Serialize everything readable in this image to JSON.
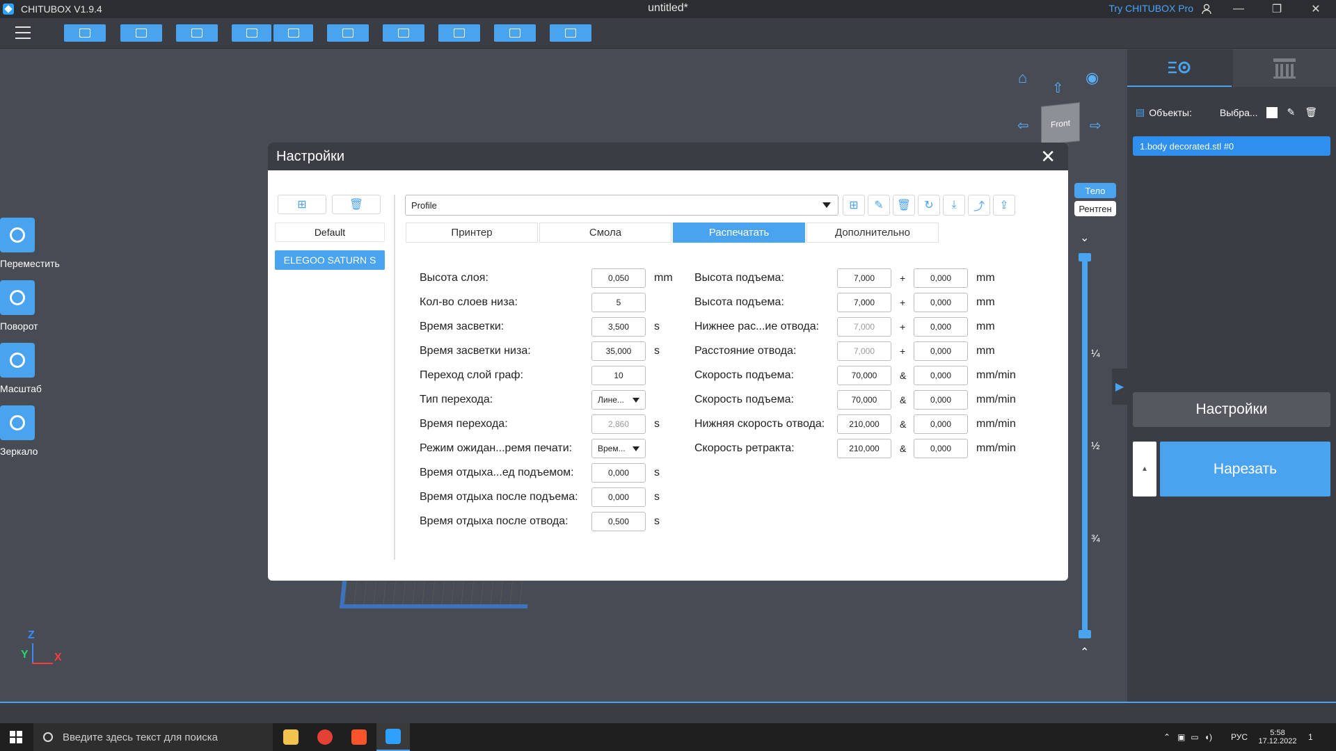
{
  "app": {
    "name": "CHITUBOX V1.9.4",
    "doc_title": "untitled*",
    "try_pro": "Try CHITUBOX Pro",
    "window_controls": {
      "minimize": "—",
      "maximize": "❐",
      "close": "✕"
    }
  },
  "left_tools": [
    {
      "label": "Переместить",
      "icon": "move-icon"
    },
    {
      "label": "Поворот",
      "icon": "rotate-icon"
    },
    {
      "label": "Масштаб",
      "icon": "scale-icon"
    },
    {
      "label": "Зеркало",
      "icon": "mirror-icon"
    }
  ],
  "view": {
    "cube_label": "Front",
    "axis_labels": {
      "z": "Z",
      "y": "Y",
      "x": "X"
    },
    "view_tabs": [
      "Тело",
      "Рентген"
    ],
    "fractions": [
      "¼",
      "½",
      "¾"
    ]
  },
  "right_panel": {
    "objects_label": "Объекты:",
    "select_label": "Выбра...",
    "object_item": "1.body decorated.stl #0",
    "settings_button": "Настройки",
    "slice_button": "Нарезать",
    "slice_side_arrow": "▲"
  },
  "modal": {
    "title": "Настройки",
    "close": "✕",
    "profiles": [
      "Default",
      "ELEGOO SATURN S"
    ],
    "selected_profile_index": 1,
    "profile_select": "Profile",
    "tabs": [
      "Принтер",
      "Смола",
      "Распечатать",
      "Дополнительно"
    ],
    "active_tab_index": 2,
    "left_params": [
      {
        "label": "Высота слоя:",
        "value": "0,050",
        "unit": "mm",
        "kind": "input"
      },
      {
        "label": "Кол-во слоев низа:",
        "value": "5",
        "unit": "",
        "kind": "input"
      },
      {
        "label": "Время засветки:",
        "value": "3,500",
        "unit": "s",
        "kind": "input"
      },
      {
        "label": "Время засветки низа:",
        "value": "35,000",
        "unit": "s",
        "kind": "input"
      },
      {
        "label": "Переход слой граф:",
        "value": "10",
        "unit": "",
        "kind": "input"
      },
      {
        "label": "Тип перехода:",
        "value": "Лине...",
        "unit": "",
        "kind": "select"
      },
      {
        "label": "Время перехода:",
        "value": "2,860",
        "unit": "s",
        "kind": "disabled"
      },
      {
        "label": "Режим ожидан...ремя печати:",
        "value": "Врем...",
        "unit": "",
        "kind": "select"
      },
      {
        "label": "Время отдыха...ед подъемом:",
        "value": "0,000",
        "unit": "s",
        "kind": "input"
      },
      {
        "label": "Время отдыха после подъема:",
        "value": "0,000",
        "unit": "s",
        "kind": "input"
      },
      {
        "label": "Время отдыха после отвода:",
        "value": "0,500",
        "unit": "s",
        "kind": "input"
      }
    ],
    "right_params": [
      {
        "label": "Высота подъема:",
        "v1": "7,000",
        "op": "+",
        "v2": "0,000",
        "unit": "mm",
        "v1_disabled": false
      },
      {
        "label": "Высота подъема:",
        "v1": "7,000",
        "op": "+",
        "v2": "0,000",
        "unit": "mm",
        "v1_disabled": false
      },
      {
        "label": "Нижнее рас...ие отвода:",
        "v1": "7,000",
        "op": "+",
        "v2": "0,000",
        "unit": "mm",
        "v1_disabled": true
      },
      {
        "label": "Расстояние отвода:",
        "v1": "7,000",
        "op": "+",
        "v2": "0,000",
        "unit": "mm",
        "v1_disabled": true
      },
      {
        "label": "Скорость подъема:",
        "v1": "70,000",
        "op": "&",
        "v2": "0,000",
        "unit": "mm/min",
        "v1_disabled": false
      },
      {
        "label": "Скорость подъема:",
        "v1": "70,000",
        "op": "&",
        "v2": "0,000",
        "unit": "mm/min",
        "v1_disabled": false
      },
      {
        "label": "Нижняя скорость отвода:",
        "v1": "210,000",
        "op": "&",
        "v2": "0,000",
        "unit": "mm/min",
        "v1_disabled": false
      },
      {
        "label": "Скорость ретракта:",
        "v1": "210,000",
        "op": "&",
        "v2": "0,000",
        "unit": "mm/min",
        "v1_disabled": false
      }
    ]
  },
  "taskbar": {
    "search_placeholder": "Введите здесь текст для поиска",
    "lang": "РУС",
    "time": "5:58",
    "date": "17.12.2022",
    "notifications": "1"
  },
  "colors": {
    "accent": "#4aa3ef",
    "chrome_dark": "#3a3d43",
    "viewport": "#474b53"
  }
}
